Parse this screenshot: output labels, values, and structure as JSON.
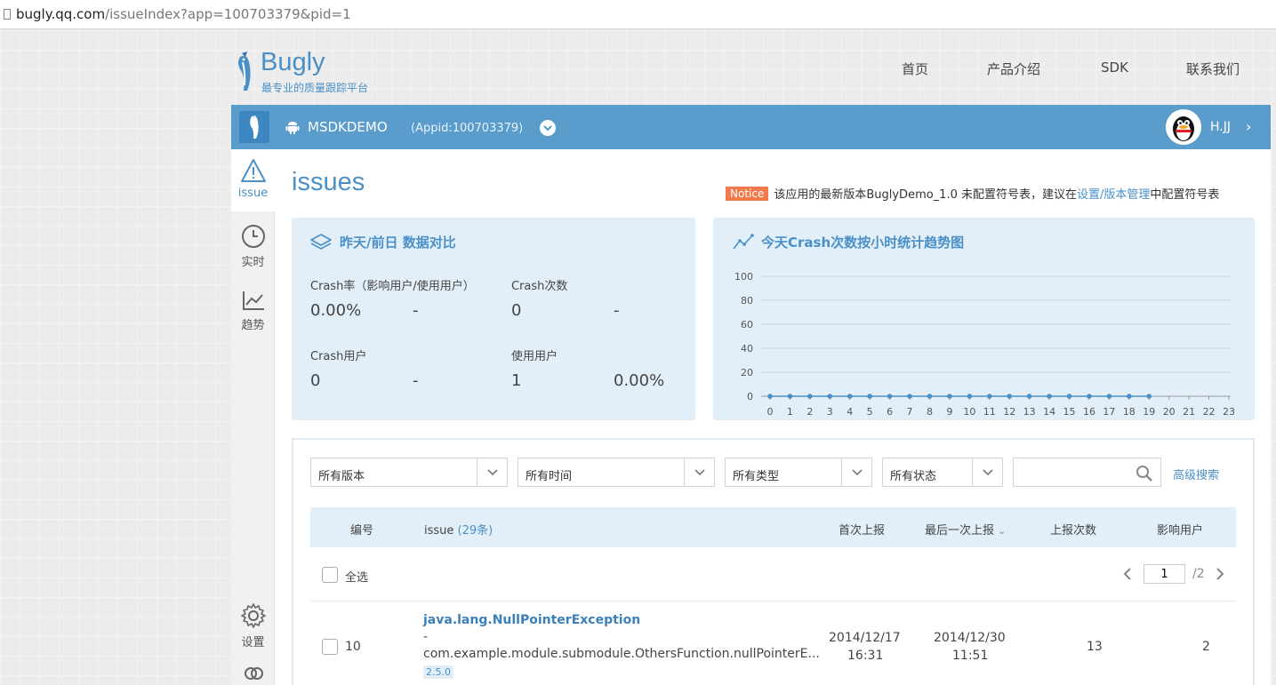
{
  "browser": {
    "url_host": "bugly.qq.com",
    "url_path": "/issueIndex?app=100703379&pid=1"
  },
  "brand": {
    "name": "Bugly",
    "slogan": "最专业的质量跟踪平台"
  },
  "topnav": [
    "首页",
    "产品介绍",
    "SDK",
    "联系我们"
  ],
  "appbar": {
    "app_name": "MSDKDEMO",
    "appid": "(Appid:100703379)",
    "user_name": "H.JJ",
    "chevron": "›"
  },
  "sidebar": {
    "items": [
      {
        "label": "issue",
        "icon": "warning-icon"
      },
      {
        "label": "实时",
        "icon": "clock-icon"
      },
      {
        "label": "趋势",
        "icon": "trend-chart-icon"
      },
      {
        "label": "设置",
        "icon": "gear-icon"
      },
      {
        "label": "",
        "icon": "users-icon"
      }
    ]
  },
  "page": {
    "title": "issues",
    "notice_badge": "Notice",
    "notice_text": "该应用的最新版本BuglyDemo_1.0 未配置符号表，建议在",
    "notice_link": "设置/版本管理",
    "notice_tail": "中配置符号表"
  },
  "compare_card": {
    "title": "昨天/前日 数据对比",
    "crash_rate_label": "Crash率（影响用户/使用用户）",
    "crash_rate_value": "0.00%",
    "crash_rate_prev": "-",
    "crash_count_label": "Crash次数",
    "crash_count_value": "0",
    "crash_count_prev": "-",
    "crash_users_label": "Crash用户",
    "crash_users_value": "0",
    "crash_users_prev": "-",
    "active_users_label": "使用用户",
    "active_users_value": "1",
    "active_users_prev": "0.00%"
  },
  "chart_data": {
    "type": "line",
    "title": "今天Crash次数按小时统计趋势图",
    "x": [
      0,
      1,
      2,
      3,
      4,
      5,
      6,
      7,
      8,
      9,
      10,
      11,
      12,
      13,
      14,
      15,
      16,
      17,
      18,
      19
    ],
    "categories": [
      "0",
      "1",
      "2",
      "3",
      "4",
      "5",
      "6",
      "7",
      "8",
      "9",
      "10",
      "11",
      "12",
      "13",
      "14",
      "15",
      "16",
      "17",
      "18",
      "19",
      "20",
      "21",
      "22",
      "23"
    ],
    "series": [
      {
        "values": [
          0,
          0,
          0,
          0,
          0,
          0,
          0,
          0,
          0,
          0,
          0,
          0,
          0,
          0,
          0,
          0,
          0,
          0,
          0,
          0
        ]
      }
    ],
    "yticks": [
      "100",
      "80",
      "60",
      "40",
      "20",
      "0"
    ],
    "ylim": [
      0,
      100
    ],
    "xlim": [
      0,
      23
    ],
    "grid": true,
    "color": "#4a90c8"
  },
  "filters": {
    "version": "所有版本",
    "time": "所有时间",
    "type": "所有类型",
    "status": "所有状态",
    "search_value": "",
    "advanced": "高级搜索"
  },
  "table": {
    "col_id": "编号",
    "col_issue": "issue",
    "issue_count": "(29条)",
    "col_first": "首次上报",
    "col_last": "最后一次上报",
    "col_reports": "上报次数",
    "col_users": "影响用户",
    "select_all": "全选",
    "page_current": "1",
    "page_total": "/2",
    "rows": [
      {
        "id": "10",
        "exception": "java.lang.NullPointerException",
        "dash": "-",
        "location": "com.example.module.submodule.OthersFunction.nullPointerE...",
        "version": "2.5.0",
        "first_date": "2014/12/17",
        "first_time": "16:31",
        "last_date": "2014/12/30",
        "last_time": "11:51",
        "reports": "13",
        "users": "2"
      }
    ]
  }
}
